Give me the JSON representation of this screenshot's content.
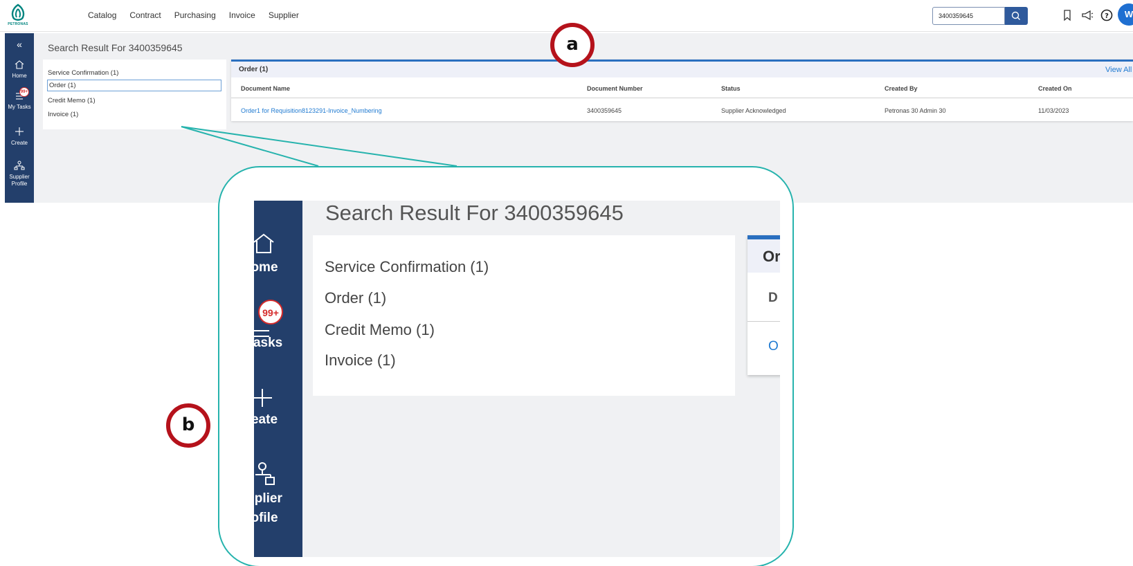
{
  "nav": {
    "logo_text": "PETRONAS",
    "menu": [
      "Catalog",
      "Contract",
      "Purchasing",
      "Invoice",
      "Supplier"
    ],
    "search_value": "3400359645",
    "avatar_initial": "W"
  },
  "sidebar": {
    "collapse_glyph": "«",
    "items": [
      {
        "label": "Home",
        "icon": "home-icon"
      },
      {
        "label": "My Tasks",
        "icon": "tasks-icon",
        "badge": "99+"
      },
      {
        "label": "Create",
        "icon": "plus-icon"
      },
      {
        "label": "Supplier Profile",
        "icon": "org-chart-icon"
      }
    ]
  },
  "page": {
    "title": "Search Result For 3400359645",
    "results": [
      "Service Confirmation (1)",
      "Order (1)",
      "Credit Memo (1)",
      "Invoice (1)"
    ],
    "selected_result": "Order (1)"
  },
  "order_panel": {
    "title": "Order (1)",
    "view_all": "View All",
    "columns": [
      "Document Name",
      "Document Number",
      "Status",
      "Created By",
      "Created On"
    ],
    "rows": [
      [
        "Order1 for Requisition8123291-Invoice_Numbering",
        "3400359645",
        "Supplier Acknowledged",
        "Petronas 30 Admin 30",
        "11/03/2023"
      ]
    ]
  },
  "annotations": {
    "marker_a": "a",
    "marker_b": "b"
  },
  "zoom": {
    "title": "Search Result For 3400359645",
    "sidebar_fragments": [
      "ome",
      "99+",
      "Tasks",
      "eate",
      "pplier",
      "ofile"
    ],
    "results": [
      "Service Confirmation (1)",
      "Order (1)",
      "Credit Memo (1)",
      "Invoice (1)"
    ],
    "order_fragments": [
      "Or",
      "D",
      "O"
    ]
  },
  "colors": {
    "sidebar": "#233f6b",
    "accent": "#2a6fbf",
    "link": "#1f7ad1",
    "marker": "#b5121b",
    "callout": "#26b3ad"
  }
}
